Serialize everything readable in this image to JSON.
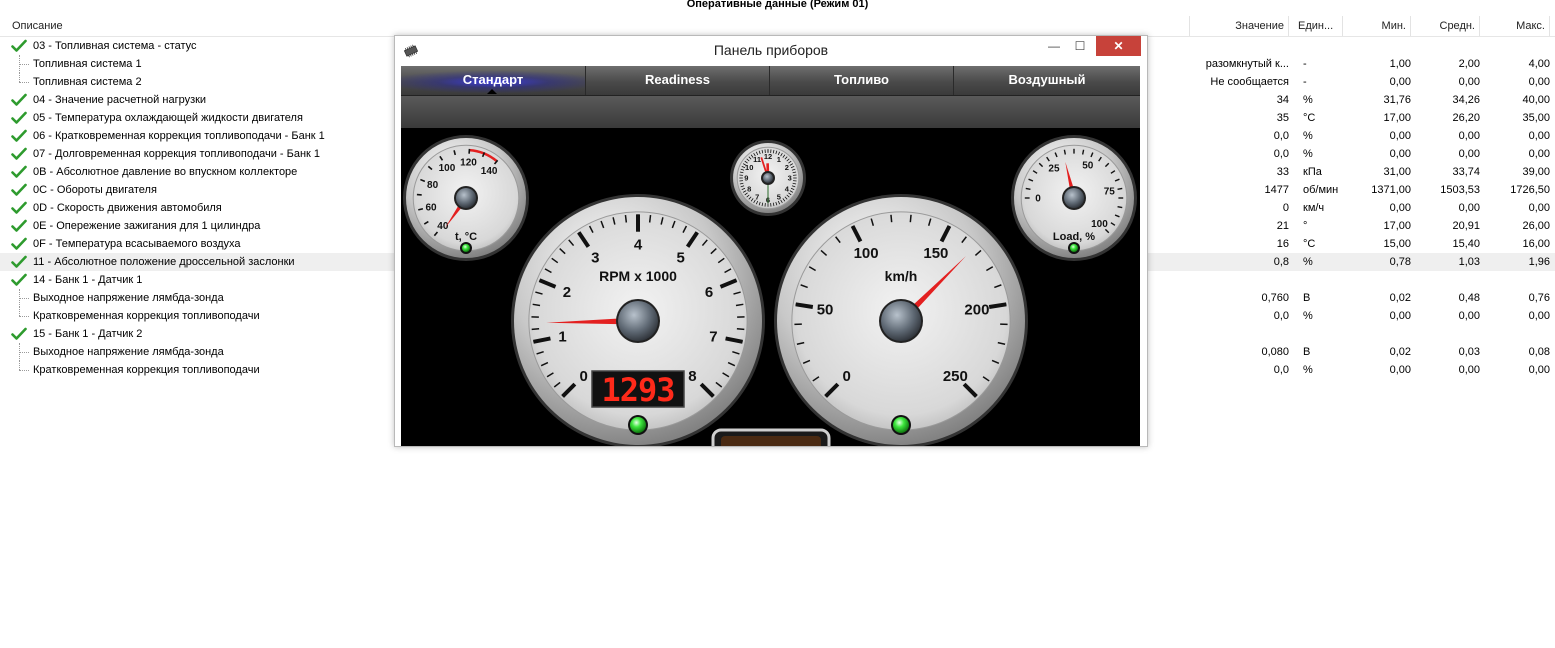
{
  "window_title": "Оперативные данные (Режим 01)",
  "table": {
    "headers": {
      "description": "Описание",
      "value": "Значение",
      "unit": "Един...",
      "min": "Мин.",
      "avg": "Средн.",
      "max": "Макс."
    },
    "rows": [
      {
        "check": true,
        "child": false,
        "desc": "03 - Топливная система - статус",
        "value": "",
        "unit": "",
        "min": "",
        "avg": "",
        "max": ""
      },
      {
        "check": false,
        "child": true,
        "desc": "Топливная система 1",
        "value": "разомкнутый к...",
        "unit": "-",
        "min": "1,00",
        "avg": "2,00",
        "max": "4,00"
      },
      {
        "check": false,
        "child": true,
        "last": true,
        "desc": "Топливная система 2",
        "value": "Не сообщается",
        "unit": "-",
        "min": "0,00",
        "avg": "0,00",
        "max": "0,00"
      },
      {
        "check": true,
        "child": false,
        "desc": "04 - Значение расчетной нагрузки",
        "value": "34",
        "unit": "%",
        "min": "31,76",
        "avg": "34,26",
        "max": "40,00"
      },
      {
        "check": true,
        "child": false,
        "desc": "05 - Температура охлаждающей жидкости двигателя",
        "value": "35",
        "unit": "°C",
        "min": "17,00",
        "avg": "26,20",
        "max": "35,00"
      },
      {
        "check": true,
        "child": false,
        "desc": "06 - Кратковременная коррекция топливоподачи - Банк 1",
        "value": "0,0",
        "unit": "%",
        "min": "0,00",
        "avg": "0,00",
        "max": "0,00"
      },
      {
        "check": true,
        "child": false,
        "desc": "07 - Долговременная коррекция топливоподачи - Банк 1",
        "value": "0,0",
        "unit": "%",
        "min": "0,00",
        "avg": "0,00",
        "max": "0,00"
      },
      {
        "check": true,
        "child": false,
        "desc": "0B - Абсолютное давление во впускном коллекторе",
        "value": "33",
        "unit": "кПа",
        "min": "31,00",
        "avg": "33,74",
        "max": "39,00"
      },
      {
        "check": true,
        "child": false,
        "desc": "0C - Обороты двигателя",
        "value": "1477",
        "unit": "об/мин",
        "min": "1371,00",
        "avg": "1503,53",
        "max": "1726,50"
      },
      {
        "check": true,
        "child": false,
        "desc": "0D - Скорость движения автомобиля",
        "value": "0",
        "unit": "км/ч",
        "min": "0,00",
        "avg": "0,00",
        "max": "0,00"
      },
      {
        "check": true,
        "child": false,
        "desc": "0E - Опережение зажигания для 1 цилиндра",
        "value": "21",
        "unit": "°",
        "min": "17,00",
        "avg": "20,91",
        "max": "26,00"
      },
      {
        "check": true,
        "child": false,
        "desc": "0F - Температура всасываемого воздуха",
        "value": "16",
        "unit": "°C",
        "min": "15,00",
        "avg": "15,40",
        "max": "16,00"
      },
      {
        "check": true,
        "child": false,
        "highlight": true,
        "desc": "11 - Абсолютное положение дроссельной заслонки",
        "value": "0,8",
        "unit": "%",
        "min": "0,78",
        "avg": "1,03",
        "max": "1,96"
      },
      {
        "check": true,
        "child": false,
        "desc": "14 - Банк 1 - Датчик 1",
        "value": "",
        "unit": "",
        "min": "",
        "avg": "",
        "max": ""
      },
      {
        "check": false,
        "child": true,
        "desc": "Выходное напряжение лямбда-зонда",
        "value": "0,760",
        "unit": "В",
        "min": "0,02",
        "avg": "0,48",
        "max": "0,76"
      },
      {
        "check": false,
        "child": true,
        "last": true,
        "desc": "Кратковременная коррекция топливоподачи",
        "value": "0,0",
        "unit": "%",
        "min": "0,00",
        "avg": "0,00",
        "max": "0,00"
      },
      {
        "check": true,
        "child": false,
        "desc": "15 - Банк 1 - Датчик 2",
        "value": "",
        "unit": "",
        "min": "",
        "avg": "",
        "max": ""
      },
      {
        "check": false,
        "child": true,
        "desc": "Выходное напряжение лямбда-зонда",
        "value": "0,080",
        "unit": "В",
        "min": "0,02",
        "avg": "0,03",
        "max": "0,08"
      },
      {
        "check": false,
        "child": true,
        "last": true,
        "desc": "Кратковременная коррекция топливоподачи",
        "value": "0,0",
        "unit": "%",
        "min": "0,00",
        "avg": "0,00",
        "max": "0,00"
      }
    ]
  },
  "dashboard": {
    "title": "Панель приборов",
    "icon": "app-chip-icon",
    "controls": {
      "minimize": "—",
      "maximize": "☐",
      "close": "✕"
    },
    "tabs": [
      {
        "label": "Стандарт",
        "active": true
      },
      {
        "label": "Readiness",
        "active": false
      },
      {
        "label": "Топливо",
        "active": false
      },
      {
        "label": "Воздушный",
        "active": false
      }
    ],
    "gauges": {
      "temp": {
        "label": "t, °C",
        "ticks": [
          "40",
          "60",
          "80",
          "100",
          "120",
          "140"
        ],
        "min": 40,
        "max": 140,
        "value": 35
      },
      "rpm": {
        "label": "RPM x 1000",
        "ticks": [
          "0",
          "1",
          "2",
          "3",
          "4",
          "5",
          "6",
          "7",
          "8"
        ],
        "min": 0,
        "max": 8,
        "value": 1.3,
        "display": "1293"
      },
      "speed": {
        "label": "km/h",
        "ticks": [
          "0",
          "50",
          "100",
          "150",
          "200",
          "250"
        ],
        "min": 0,
        "max": 250,
        "value": 0
      },
      "load": {
        "label": "Load, %",
        "ticks": [
          "0",
          "25",
          "50",
          "75",
          "100"
        ],
        "min": 0,
        "max": 100,
        "value": 34
      },
      "clock": {
        "numbers": [
          "12",
          "1",
          "2",
          "3",
          "4",
          "5",
          "6",
          "7",
          "8",
          "9",
          "10",
          "11"
        ],
        "hour": 11.95,
        "minute": 57,
        "second": 30
      }
    },
    "colors": {
      "needle": "#e32020",
      "led": "#3de63d",
      "display_digits": "#ff2a1a",
      "tab_active_glow": "#3b3bd8",
      "close_button": "#c7423a"
    }
  }
}
